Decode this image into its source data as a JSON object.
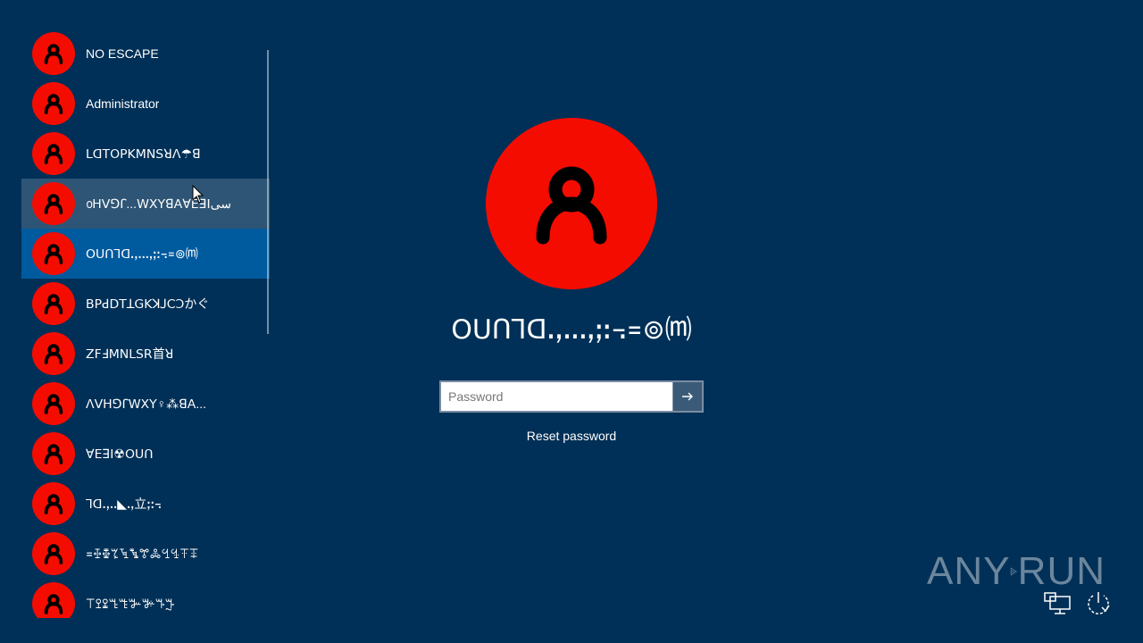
{
  "colors": {
    "background": "#003057",
    "avatar": "#f50c00",
    "selected_row": "#005a9e",
    "hover_row": "rgba(255,255,255,0.18)"
  },
  "users": [
    {
      "name": "NO ESCAPE",
      "state": "normal"
    },
    {
      "name": "Administrator",
      "state": "normal"
    },
    {
      "name": "ꓡꓷꓔꓳꓑꓗꓟꓠꓢꓤꓥ☂ꓭ",
      "state": "normal"
    },
    {
      "name": "൦ꓧꓦꓨꓩ...ꓪꓫꓬꓭꓮꓯꓰꓱꓲسی",
      "state": "hover"
    },
    {
      "name": "ꓳꓴꓵꓶꓷꓸꓹꓺꓻꓼꓽ꓾꓿⊚⒨",
      "state": "selected"
    },
    {
      "name": "ꓐꓑꓒꓓꓔꓕꓖꓗꓘꓙꓚꓛかぐ",
      "state": "normal"
    },
    {
      "name": "ꓜꓝꓞꓟꓠꓡꓢꓣ首ꓤ",
      "state": "normal"
    },
    {
      "name": "ꓥꓦꓧꓨꓩꓪꓫꓬ♀⁂ꓭꓮ...",
      "state": "normal"
    },
    {
      "name": "ꓯꓰꓱꓲ☢ꓳꓴꓵ",
      "state": "normal"
    },
    {
      "name": "ꓶꓷꓸꓹꓺ◣ꓻ立ꓼꓽ꓾",
      "state": "normal"
    },
    {
      "name": "꓿ꔀꔁꔂꔃꔄꔅꔆꔇꔈꔉꔊ",
      "state": "normal"
    },
    {
      "name": "ꔋꔌꔍꔎꔏꔐꔑꔒꔓ",
      "state": "normal"
    }
  ],
  "selected_user": {
    "name": "ꓳꓴꓵꓶꓷꓸꓹꓺꓻꓼꓽ꓾꓿⊚⒨"
  },
  "login": {
    "password_placeholder": "Password",
    "password_value": "",
    "submit_icon": "arrow-right-icon",
    "reset_label": "Reset password"
  },
  "watermark": {
    "left": "ANY",
    "right": "RUN"
  },
  "system_icons": {
    "network": "network-icon",
    "power": "power-icon"
  }
}
